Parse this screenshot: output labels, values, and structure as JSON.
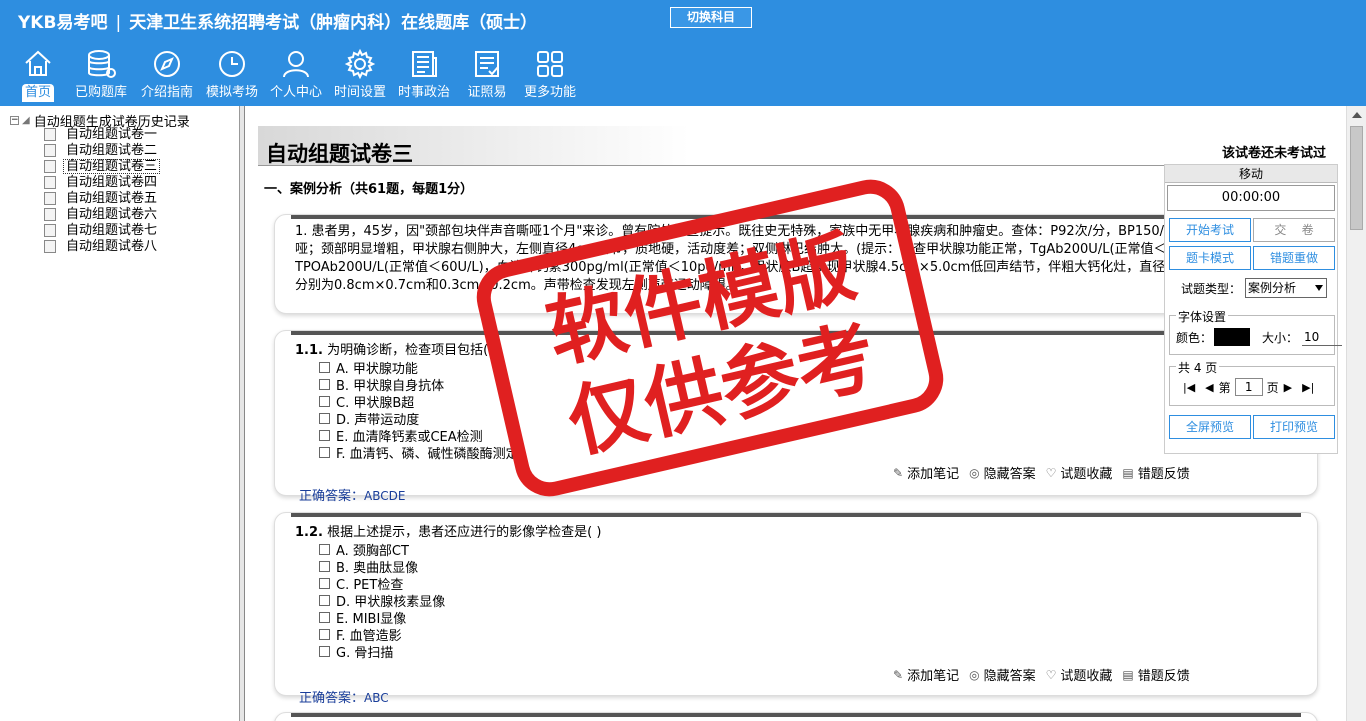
{
  "header": {
    "brand": "YKB易考吧",
    "title": "天津卫生系统招聘考试（肿瘤内科）在线题库（硕士）",
    "switch_button": "切换科目"
  },
  "nav": [
    {
      "label": "首页",
      "icon": "home-icon"
    },
    {
      "label": "已购题库",
      "icon": "database-icon"
    },
    {
      "label": "介绍指南",
      "icon": "compass-icon"
    },
    {
      "label": "模拟考场",
      "icon": "clock-icon"
    },
    {
      "label": "个人中心",
      "icon": "user-icon"
    },
    {
      "label": "时间设置",
      "icon": "gear-icon"
    },
    {
      "label": "时事政治",
      "icon": "newspaper-icon"
    },
    {
      "label": "证照易",
      "icon": "checklist-icon"
    },
    {
      "label": "更多功能",
      "icon": "grid-icon"
    }
  ],
  "tree": {
    "root": "自动组题生成试卷历史记录",
    "items": [
      "自动组题试卷一",
      "自动组题试卷二",
      "自动组题试卷三",
      "自动组题试卷四",
      "自动组题试卷五",
      "自动组题试卷六",
      "自动组题试卷七",
      "自动组题试卷八"
    ],
    "selected": "自动组题试卷三"
  },
  "paper": {
    "title": "自动组题试卷三",
    "status": "该试卷还未考试过",
    "section": "一、案例分析（共61题，每题1分）"
  },
  "case": {
    "text": "1. 患者男，45岁，因\"颈部包块伴声音嘶哑1个月\"来诊。曾有院外检查提示。既往史无特殊，家族中无甲状腺疾病和肿瘤史。查体：P92次/分，BP150/100mmHg；声音嘶哑；颈部明显增粗，甲状腺右侧肿大，左侧直径4cm结节，质地硬，活动度差；双侧淋巴结肿大。(提示：检查甲状腺功能正常，TgAb200U/L(正常值＜150U/L)，TPOAb200U/L(正常值＜60U/L)，血清降钙素300pg/ml(正常值＜10pg/ml)，甲状腺B超发现甲状腺4.5cm×5.0cm低回声结节，伴粗大钙化灶，直径0.2cm，其余结节直径分别为0.8cm×0.7cm和0.3cm×0.2cm。声带检查发现左侧声带运动障碍。)"
  },
  "questions": [
    {
      "number": "1.1.",
      "text": "为明确诊断，检查项目包括( )",
      "options": [
        "A. 甲状腺功能",
        "B. 甲状腺自身抗体",
        "C. 甲状腺B超",
        "D. 声带运动度",
        "E. 血清降钙素或CEA检测",
        "F. 血清钙、磷、碱性磷酸酶测定"
      ],
      "answer_label": "正确答案：",
      "answer": "ABCDE"
    },
    {
      "number": "1.2.",
      "text": "根据上述提示，患者还应进行的影像学检查是( )",
      "options": [
        "A. 颈胸部CT",
        "B. 奥曲肽显像",
        "C. PET检查",
        "D. 甲状腺核素显像",
        "E. MIBI显像",
        "F. 血管造影",
        "G. 骨扫描"
      ],
      "answer_label": "正确答案：",
      "answer": "ABC"
    }
  ],
  "tools": [
    "添加笔记",
    "隐藏答案",
    "试题收藏",
    "错题反馈"
  ],
  "panel": {
    "move": "移动",
    "timer": "00:00:00",
    "start_exam": "开始考试",
    "submit": "交    卷",
    "card_mode": "题卡模式",
    "redo_wrong": "错题重做",
    "type_label": "试题类型：",
    "type_value": "案例分析",
    "font_legend": "字体设置",
    "color_label": "颜色：",
    "color_value": "#000000",
    "size_label": "大小：",
    "size_value": "10",
    "pages_legend": "共 4 页",
    "page_prefix": "第",
    "page_value": "1",
    "page_suffix": "页",
    "fullscreen": "全屏预览",
    "print": "打印预览"
  },
  "watermark": {
    "line1": "软件模版",
    "line2": "仅供参考",
    "color": "#e02020"
  },
  "colors": {
    "topbar": "#2e8ee0",
    "answer": "#1a3e9a"
  }
}
